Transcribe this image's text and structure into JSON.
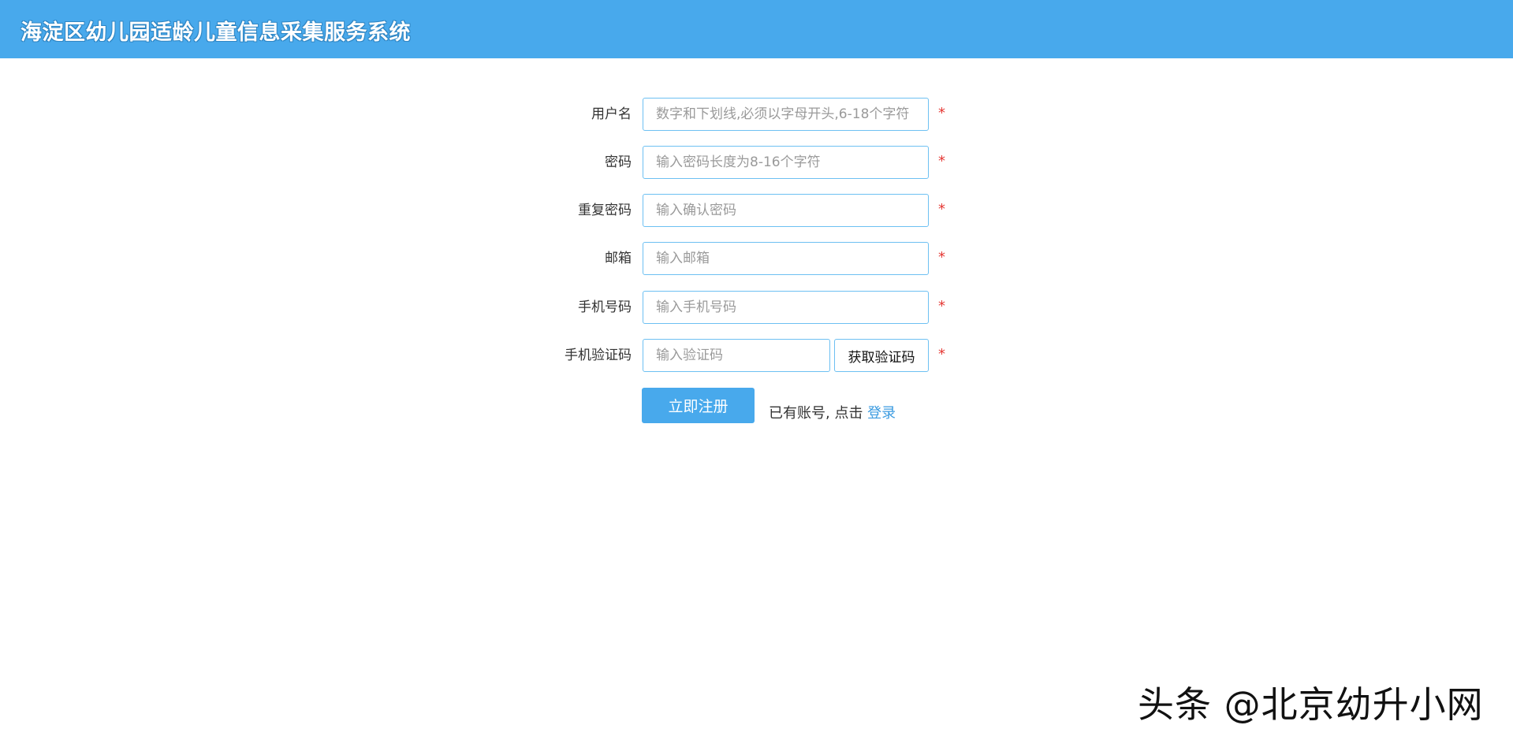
{
  "header": {
    "title": "海淀区幼儿园适龄儿童信息采集服务系统"
  },
  "form": {
    "fields": [
      {
        "label": "用户名",
        "placeholder": "数字和下划线,必须以字母开头,6-18个字符",
        "required_mark": "*"
      },
      {
        "label": "密码",
        "placeholder": "输入密码长度为8-16个字符",
        "required_mark": "*"
      },
      {
        "label": "重复密码",
        "placeholder": "输入确认密码",
        "required_mark": "*"
      },
      {
        "label": "邮箱",
        "placeholder": "输入邮箱",
        "required_mark": "*"
      },
      {
        "label": "手机号码",
        "placeholder": "输入手机号码",
        "required_mark": "*"
      },
      {
        "label": "手机验证码",
        "placeholder": "输入验证码",
        "required_mark": "*"
      }
    ],
    "get_code_label": "获取验证码",
    "submit_label": "立即注册",
    "login_prompt": "已有账号, 点击 ",
    "login_link": "登录"
  },
  "watermark": "头条 @北京幼升小网",
  "colors": {
    "brand": "#48a9ec",
    "required": "#e53935",
    "link": "#3b9be0"
  }
}
